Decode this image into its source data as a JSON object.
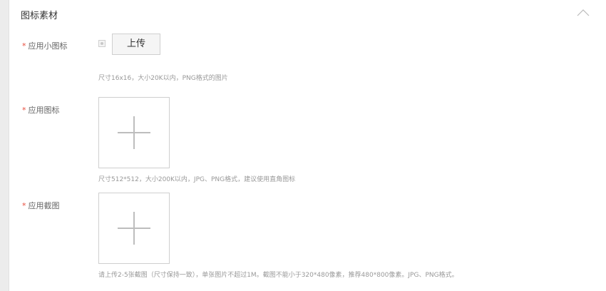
{
  "section": {
    "title": "图标素材"
  },
  "small_icon": {
    "required_mark": "*",
    "label": "应用小图标",
    "button_label": "上传",
    "hint": "尺寸16x16，大小20K以内，PNG格式的图片"
  },
  "app_icon": {
    "required_mark": "*",
    "label": "应用图标",
    "hint": "尺寸512*512，大小200K以内，JPG、PNG格式，建议使用直角图标"
  },
  "screenshots": {
    "required_mark": "*",
    "label": "应用截图",
    "hint": "请上传2-5张截图（尺寸保持一致），单张图片不超过1M。截图不能小于320*480像素，推荐480*800像素。JPG、PNG格式。"
  },
  "icons": {
    "collapse": "chevron-up-icon",
    "add": "plus-icon"
  },
  "colors": {
    "required": "#e74c3c",
    "hint_text": "#999999",
    "border": "#cfcfcf"
  }
}
